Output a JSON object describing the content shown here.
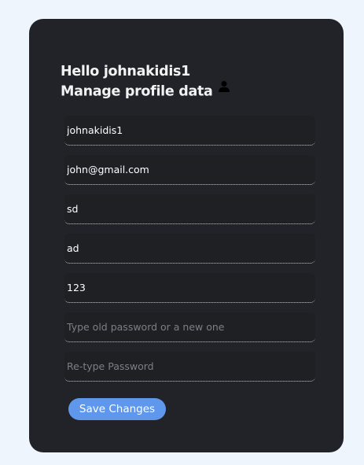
{
  "profile": {
    "greeting": "Hello johnakidis1",
    "subtitle": "Manage profile data",
    "icon": "user-icon"
  },
  "form": {
    "fields": [
      {
        "name": "username",
        "value": "johnakidis1",
        "placeholder": ""
      },
      {
        "name": "email",
        "value": "john@gmail.com",
        "placeholder": ""
      },
      {
        "name": "first_name",
        "value": "sd",
        "placeholder": ""
      },
      {
        "name": "last_name",
        "value": "ad",
        "placeholder": ""
      },
      {
        "name": "phone",
        "value": "123",
        "placeholder": ""
      },
      {
        "name": "password",
        "value": "",
        "placeholder": "Type old password or a new one"
      },
      {
        "name": "retype_password",
        "value": "",
        "placeholder": "Re-type Password"
      }
    ],
    "save_label": "Save Changes"
  },
  "colors": {
    "page_background": "#eef5fd",
    "card_background": "#212328",
    "button_accent": "#5f97ec"
  }
}
